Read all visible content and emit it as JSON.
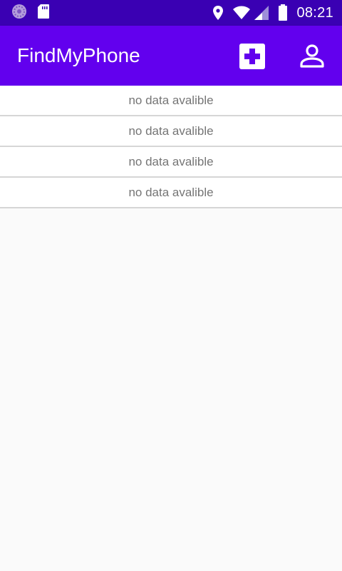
{
  "status_bar": {
    "time": "08:21",
    "icons": [
      "sync-icon",
      "sd-card-icon",
      "location-icon",
      "wifi-icon",
      "signal-icon",
      "battery-icon"
    ],
    "background_color": "#3a00b3"
  },
  "app_bar": {
    "title": "FindMyPhone",
    "background_color": "#6200ee",
    "actions": [
      {
        "icon": "add-box-icon"
      },
      {
        "icon": "person-icon"
      }
    ]
  },
  "list": {
    "items": [
      {
        "text": "no data avalible"
      },
      {
        "text": "no data avalible"
      },
      {
        "text": "no data avalible"
      },
      {
        "text": "no data avalible"
      }
    ]
  }
}
